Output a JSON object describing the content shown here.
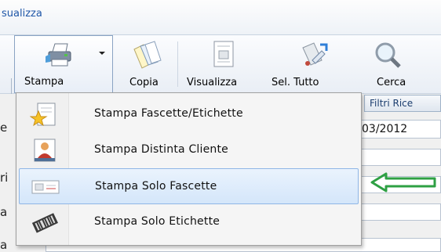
{
  "header": {
    "tab_label": "sualizza"
  },
  "toolbar": {
    "stampa": {
      "label": "Stampa",
      "icon": "printer-icon"
    },
    "copia": {
      "label": "Copia",
      "icon": "copy-pages-icon"
    },
    "visualizza": {
      "label": "Visualizza",
      "icon": "document-view-icon"
    },
    "sel_tutto": {
      "label": "Sel. Tutto",
      "icon": "select-all-icon"
    },
    "cerca": {
      "label": "Cerca",
      "icon": "magnifier-icon"
    }
  },
  "background": {
    "filtri_tab": "Filtri Rice",
    "date_value": "03/2012",
    "side_letters": [
      "e",
      "ri",
      "a",
      "a"
    ]
  },
  "menu": {
    "items": [
      {
        "label": "Stampa Fascette/Etichette",
        "icon": "star-document-icon",
        "selected": false
      },
      {
        "label": "Stampa Distinta Cliente",
        "icon": "customer-card-icon",
        "selected": false
      },
      {
        "label": "Stampa Solo Fascette",
        "icon": "band-label-icon",
        "selected": true
      },
      {
        "label": "Stampa Solo Etichette",
        "icon": "barcode-label-icon",
        "selected": false
      }
    ]
  },
  "annotation": {
    "arrow_color": "#2ea043"
  }
}
